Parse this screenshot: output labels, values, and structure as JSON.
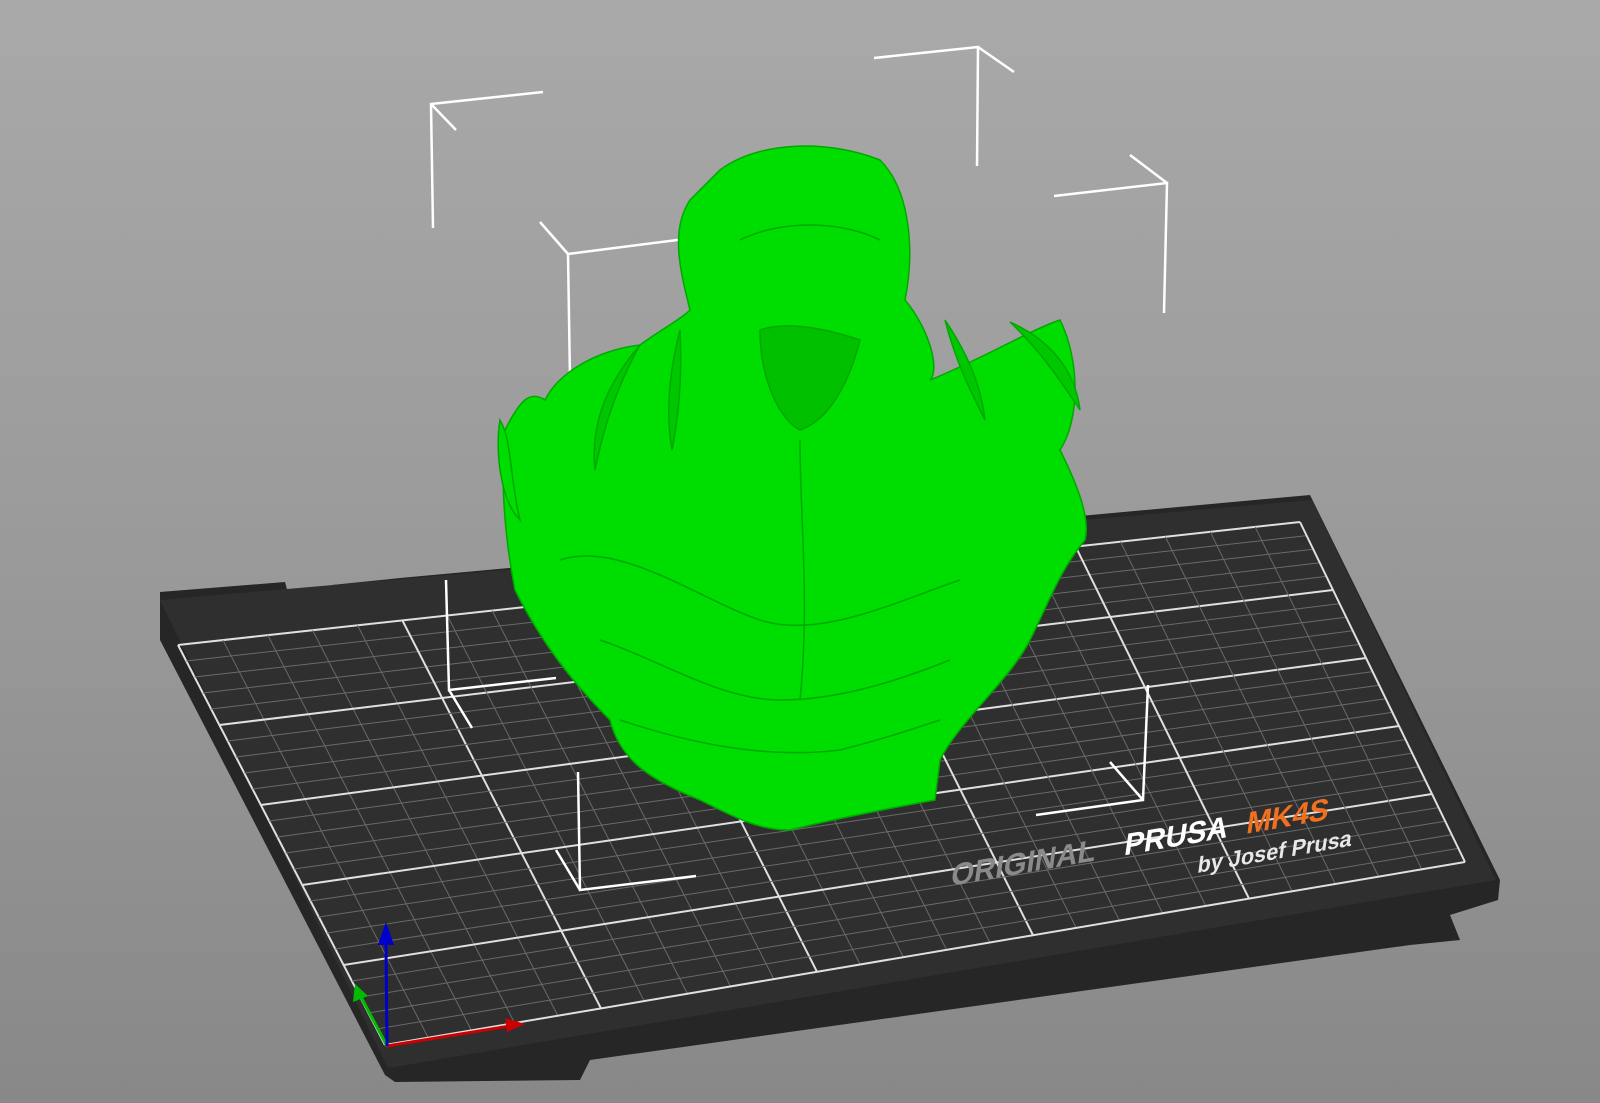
{
  "viewport": {
    "model_color": "#00dd00",
    "bed_color": "#333333",
    "bed_logo": {
      "line1_prefix": "ORIGINAL",
      "line1_brand": "PRUSA",
      "line1_model": "MK4S",
      "line2": "by Josef Prusa",
      "accent_color": "#f07020"
    },
    "axes": {
      "x_color": "#cc0000",
      "y_color": "#00bb00",
      "z_color": "#0000cc"
    }
  }
}
